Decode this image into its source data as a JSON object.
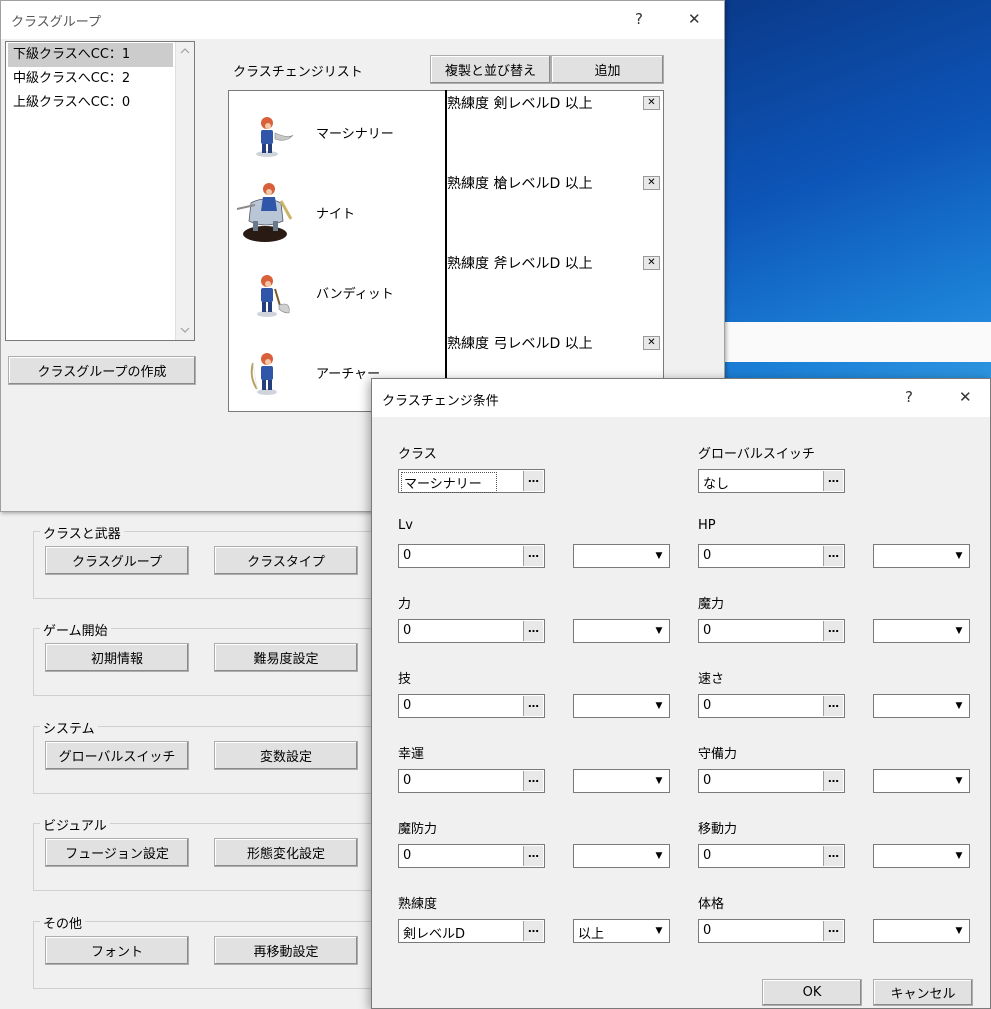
{
  "class_group_window": {
    "title": "クラスグループ",
    "help": "?",
    "close": "✕",
    "list_items": [
      "下級クラスへCC：1",
      "中級クラスへCC：2",
      "上級クラスへCC：0"
    ],
    "create_button": "クラスグループの作成",
    "cc_list_label": "クラスチェンジリスト",
    "duplicate_sort_button": "複製と並び替え",
    "add_button": "追加",
    "entries": [
      {
        "name": "マーシナリー",
        "condition": "熟練度 剣レベルD 以上"
      },
      {
        "name": "ナイト",
        "condition": "熟練度 槍レベルD 以上"
      },
      {
        "name": "バンディット",
        "condition": "熟練度 斧レベルD 以上"
      },
      {
        "name": "アーチャー",
        "condition": "熟練度 弓レベルD 以上"
      }
    ]
  },
  "main_window": {
    "groups": [
      {
        "title": "クラスと武器",
        "buttons": [
          "クラスグループ",
          "クラスタイプ"
        ]
      },
      {
        "title": "ゲーム開始",
        "buttons": [
          "初期情報",
          "難易度設定"
        ]
      },
      {
        "title": "システム",
        "buttons": [
          "グローバルスイッチ",
          "変数設定"
        ]
      },
      {
        "title": "ビジュアル",
        "buttons": [
          "フュージョン設定",
          "形態変化設定"
        ]
      },
      {
        "title": "その他",
        "buttons": [
          "フォント",
          "再移動設定"
        ]
      }
    ]
  },
  "dialog": {
    "title": "クラスチェンジ条件",
    "help": "?",
    "close": "✕",
    "class_label": "クラス",
    "class_value": "マーシナリー",
    "switch_label": "グローバルスイッチ",
    "switch_value": "なし",
    "dots": "…",
    "left_fields": [
      {
        "label": "Lv",
        "value": "0",
        "op": ""
      },
      {
        "label": "力",
        "value": "0",
        "op": ""
      },
      {
        "label": "技",
        "value": "0",
        "op": ""
      },
      {
        "label": "幸運",
        "value": "0",
        "op": ""
      },
      {
        "label": "魔防力",
        "value": "0",
        "op": ""
      },
      {
        "label": "熟練度",
        "value": "剣レベルD",
        "op": "以上"
      }
    ],
    "right_fields": [
      {
        "label": "HP",
        "value": "0",
        "op": ""
      },
      {
        "label": "魔力",
        "value": "0",
        "op": ""
      },
      {
        "label": "速さ",
        "value": "0",
        "op": ""
      },
      {
        "label": "守備力",
        "value": "0",
        "op": ""
      },
      {
        "label": "移動力",
        "value": "0",
        "op": ""
      },
      {
        "label": "体格",
        "value": "0",
        "op": ""
      }
    ],
    "ok_button": "OK",
    "cancel_button": "キャンセル"
  }
}
